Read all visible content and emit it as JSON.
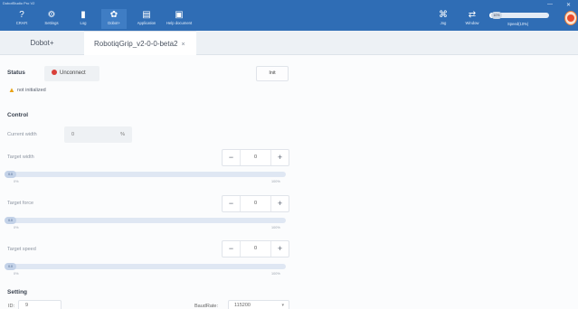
{
  "window": {
    "title": "DobotStudio Pro V2"
  },
  "toolbar": {
    "items": [
      {
        "label": "CRAFt",
        "icon": "question-icon"
      },
      {
        "label": "Settings",
        "icon": "gear-icon"
      },
      {
        "label": "Log",
        "icon": "log-icon"
      },
      {
        "label": "Dobot+",
        "icon": "plugin-icon"
      },
      {
        "label": "Application",
        "icon": "application-icon"
      },
      {
        "label": "Help document",
        "icon": "help-document-icon"
      }
    ],
    "right_items": [
      {
        "label": "Jog",
        "icon": "jog-icon"
      },
      {
        "label": "Window",
        "icon": "window-icon"
      }
    ],
    "speed": {
      "knob_label": "10%",
      "label": "Speed(10%)",
      "value_percent": 10
    }
  },
  "tabs": [
    {
      "label": "Dobot+",
      "active": false
    },
    {
      "label": "RobotiqGrip_v2-0-0-beta2",
      "active": true,
      "close": "×"
    }
  ],
  "status": {
    "heading": "Status",
    "connection": "Unconnect",
    "init_button": "Init",
    "warning": "not initialized"
  },
  "control": {
    "heading": "Control",
    "current_width": {
      "label": "Current width",
      "value": "0",
      "unit": "%"
    },
    "sliders": [
      {
        "label": "Target width",
        "value": "0",
        "knob": "0.0",
        "min_label": "0%",
        "max_label": "100%",
        "fraction": 0
      },
      {
        "label": "Target force",
        "value": "0",
        "knob": "0.0",
        "min_label": "0%",
        "max_label": "100%",
        "fraction": 0
      },
      {
        "label": "Target speed",
        "value": "0",
        "knob": "0.0",
        "min_label": "0%",
        "max_label": "100%",
        "fraction": 0
      }
    ],
    "minus": "−",
    "plus": "+"
  },
  "setting": {
    "heading": "Setting",
    "id_label": "ID:",
    "id_value": "9",
    "baud_label": "BaudRate:",
    "baud_value": "115200"
  },
  "colors": {
    "accent": "#2f6db5",
    "danger": "#d9403a",
    "warning": "#e9a316"
  }
}
